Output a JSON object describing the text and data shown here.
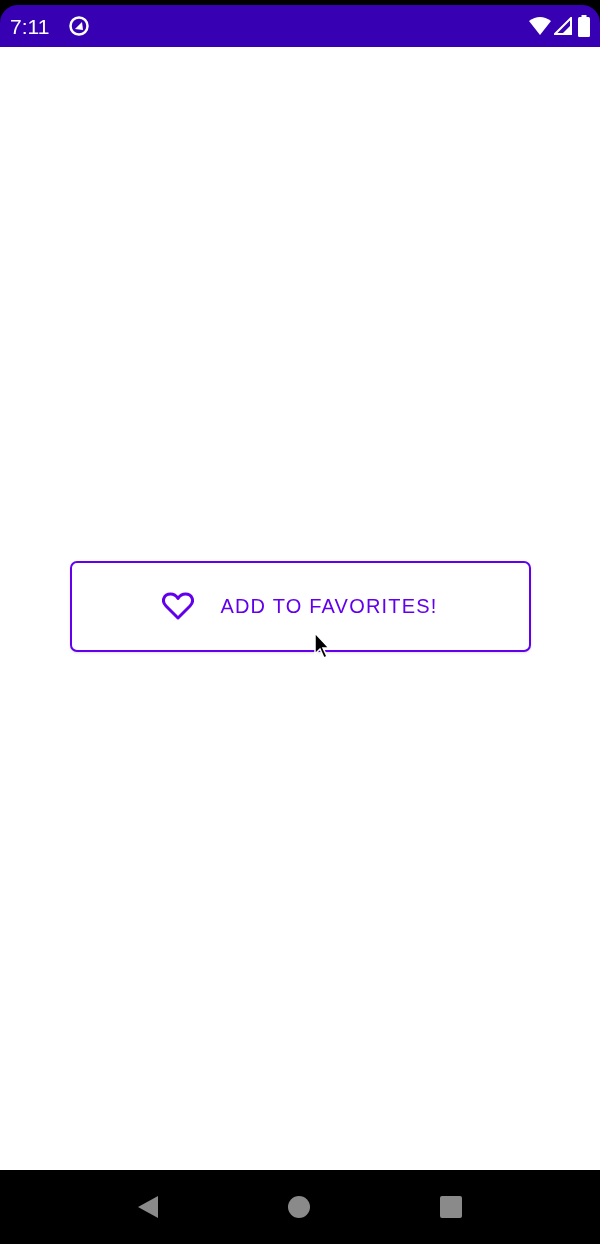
{
  "status_bar": {
    "time": "7:11"
  },
  "button": {
    "label": "ADD TO FAVORITES!"
  }
}
